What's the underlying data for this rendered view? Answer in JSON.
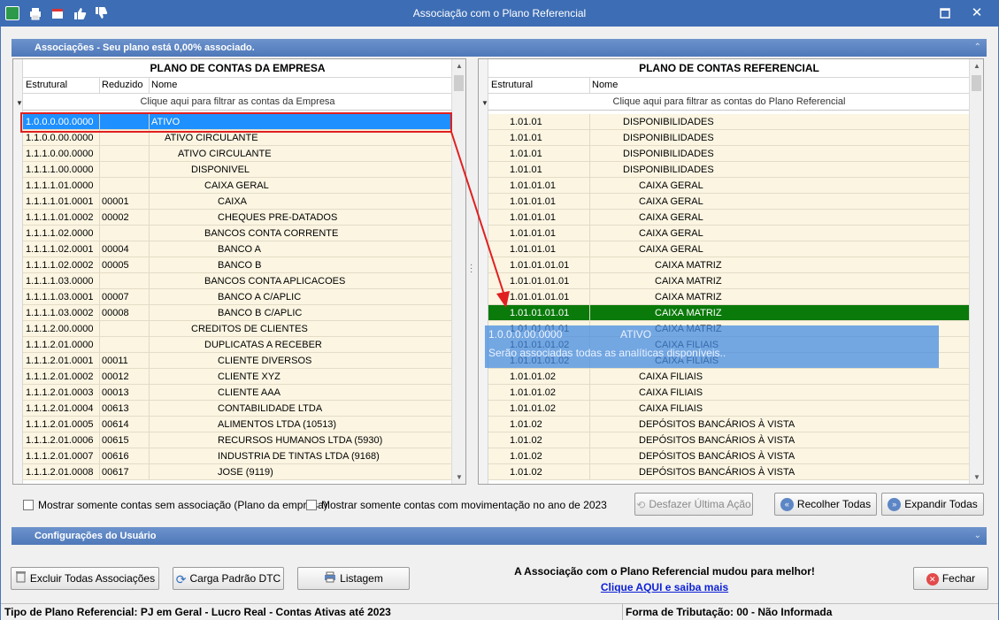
{
  "window": {
    "title": "Associação com o Plano Referencial"
  },
  "sections": {
    "associacoes": "Associações - Seu plano está 0,00% associado.",
    "config": "Configurações do Usuário"
  },
  "left_grid": {
    "title": "PLANO DE CONTAS DA EMPRESA",
    "col_estrutural": "Estrutural",
    "col_reduzido": "Reduzido",
    "col_nome": "Nome",
    "filter": "Clique aqui para filtrar as contas da Empresa",
    "rows": [
      {
        "e": "1.0.0.0.00.0000",
        "r": "",
        "n": "ATIVO",
        "lvl": 0
      },
      {
        "e": "1.1.0.0.00.0000",
        "r": "",
        "n": "ATIVO CIRCULANTE",
        "lvl": 1
      },
      {
        "e": "1.1.1.0.00.0000",
        "r": "",
        "n": "ATIVO CIRCULANTE",
        "lvl": 2
      },
      {
        "e": "1.1.1.1.00.0000",
        "r": "",
        "n": "DISPONIVEL",
        "lvl": 3
      },
      {
        "e": "1.1.1.1.01.0000",
        "r": "",
        "n": "CAIXA GERAL",
        "lvl": 4
      },
      {
        "e": "1.1.1.1.01.0001",
        "r": "00001",
        "n": "CAIXA",
        "lvl": 5
      },
      {
        "e": "1.1.1.1.01.0002",
        "r": "00002",
        "n": "CHEQUES PRE-DATADOS",
        "lvl": 5
      },
      {
        "e": "1.1.1.1.02.0000",
        "r": "",
        "n": "BANCOS CONTA CORRENTE",
        "lvl": 4
      },
      {
        "e": "1.1.1.1.02.0001",
        "r": "00004",
        "n": "BANCO A",
        "lvl": 5
      },
      {
        "e": "1.1.1.1.02.0002",
        "r": "00005",
        "n": "BANCO B",
        "lvl": 5
      },
      {
        "e": "1.1.1.1.03.0000",
        "r": "",
        "n": "BANCOS CONTA APLICACOES",
        "lvl": 4
      },
      {
        "e": "1.1.1.1.03.0001",
        "r": "00007",
        "n": "BANCO A C/APLIC",
        "lvl": 5
      },
      {
        "e": "1.1.1.1.03.0002",
        "r": "00008",
        "n": "BANCO B C/APLIC",
        "lvl": 5
      },
      {
        "e": "1.1.1.2.00.0000",
        "r": "",
        "n": "CREDITOS DE CLIENTES",
        "lvl": 3
      },
      {
        "e": "1.1.1.2.01.0000",
        "r": "",
        "n": "DUPLICATAS A RECEBER",
        "lvl": 4
      },
      {
        "e": "1.1.1.2.01.0001",
        "r": "00011",
        "n": "CLIENTE DIVERSOS",
        "lvl": 5
      },
      {
        "e": "1.1.1.2.01.0002",
        "r": "00012",
        "n": "CLIENTE XYZ",
        "lvl": 5
      },
      {
        "e": "1.1.1.2.01.0003",
        "r": "00013",
        "n": "CLIENTE AAA",
        "lvl": 5
      },
      {
        "e": "1.1.1.2.01.0004",
        "r": "00613",
        "n": "CONTABILIDADE LTDA",
        "lvl": 5
      },
      {
        "e": "1.1.1.2.01.0005",
        "r": "00614",
        "n": "ALIMENTOS LTDA (10513)",
        "lvl": 5
      },
      {
        "e": "1.1.1.2.01.0006",
        "r": "00615",
        "n": "RECURSOS HUMANOS LTDA (5930)",
        "lvl": 5
      },
      {
        "e": "1.1.1.2.01.0007",
        "r": "00616",
        "n": "INDUSTRIA DE TINTAS  LTDA (9168)",
        "lvl": 5
      },
      {
        "e": "1.1.1.2.01.0008",
        "r": "00617",
        "n": "JOSE (9119)",
        "lvl": 5
      }
    ]
  },
  "right_grid": {
    "title": "PLANO DE CONTAS REFERENCIAL",
    "col_estrutural": "Estrutural",
    "col_nome": "Nome",
    "filter": "Clique aqui para filtrar as contas do Plano Referencial",
    "rows": [
      {
        "e": "1.01.01",
        "n": "DISPONIBILIDADES",
        "lvl": 0
      },
      {
        "e": "1.01.01",
        "n": "DISPONIBILIDADES",
        "lvl": 0
      },
      {
        "e": "1.01.01",
        "n": "DISPONIBILIDADES",
        "lvl": 0
      },
      {
        "e": "1.01.01",
        "n": "DISPONIBILIDADES",
        "lvl": 0
      },
      {
        "e": "1.01.01.01",
        "n": "CAIXA GERAL",
        "lvl": 1
      },
      {
        "e": "1.01.01.01",
        "n": "CAIXA GERAL",
        "lvl": 1
      },
      {
        "e": "1.01.01.01",
        "n": "CAIXA GERAL",
        "lvl": 1
      },
      {
        "e": "1.01.01.01",
        "n": "CAIXA GERAL",
        "lvl": 1
      },
      {
        "e": "1.01.01.01",
        "n": "CAIXA GERAL",
        "lvl": 1
      },
      {
        "e": "1.01.01.01.01",
        "n": "CAIXA MATRIZ",
        "lvl": 2
      },
      {
        "e": "1.01.01.01.01",
        "n": "CAIXA MATRIZ",
        "lvl": 2
      },
      {
        "e": "1.01.01.01.01",
        "n": "CAIXA MATRIZ",
        "lvl": 2
      },
      {
        "e": "1.01.01.01.01",
        "n": "CAIXA MATRIZ",
        "lvl": 2
      },
      {
        "e": "1.01.01.01.01",
        "n": "CAIXA MATRIZ",
        "lvl": 2
      },
      {
        "e": "1.01.01.01.02",
        "n": "CAIXA FILIAIS",
        "lvl": 2
      },
      {
        "e": "1.01.01.01.02",
        "n": "CAIXA FILIAIS",
        "lvl": 2
      },
      {
        "e": "1.01.01.02",
        "n": "CAIXA FILIAIS",
        "lvl": 1
      },
      {
        "e": "1.01.01.02",
        "n": "CAIXA FILIAIS",
        "lvl": 1
      },
      {
        "e": "1.01.01.02",
        "n": "CAIXA FILIAIS",
        "lvl": 1
      },
      {
        "e": "1.01.02",
        "n": "DEPÓSITOS BANCÁRIOS À VISTA",
        "lvl": 1
      },
      {
        "e": "1.01.02",
        "n": "DEPÓSITOS BANCÁRIOS À VISTA",
        "lvl": 1
      },
      {
        "e": "1.01.02",
        "n": "DEPÓSITOS BANCÁRIOS À VISTA",
        "lvl": 1
      },
      {
        "e": "1.01.02",
        "n": "DEPÓSITOS BANCÁRIOS À VISTA",
        "lvl": 1
      }
    ]
  },
  "drag": {
    "code": "1.0.0.0.00.0000",
    "name": "ATIVO",
    "hint": "Serão associadas todas as analíticas disponíveis.."
  },
  "options": {
    "chk_sem_assoc": "Mostrar somente contas sem associação (Plano da empresa)",
    "chk_movimentacao": "Mostrar somente contas com movimentação no ano de 2023",
    "desfazer": "Desfazer Última Ação",
    "recolher": "Recolher Todas",
    "expandir": "Expandir Todas"
  },
  "bottom": {
    "excluir": "Excluir Todas Associações",
    "carga": "Carga Padrão DTC",
    "listagem": "Listagem",
    "promo": "A Associação com o Plano Referencial mudou para melhor!",
    "promo_link": "Clique AQUI e saiba mais",
    "fechar": "Fechar"
  },
  "status": {
    "left": "Tipo de Plano Referencial: PJ em Geral - Lucro Real - Contas Ativas até 2023",
    "right": "Forma de Tributação: 00 - Não Informada"
  },
  "colors": {
    "titlebar": "#3d6db4",
    "row_bg": "#fbf5e2",
    "selected_left": "#1e90ff",
    "selected_right": "#0a7a0a",
    "drag_line": "#e02020"
  }
}
